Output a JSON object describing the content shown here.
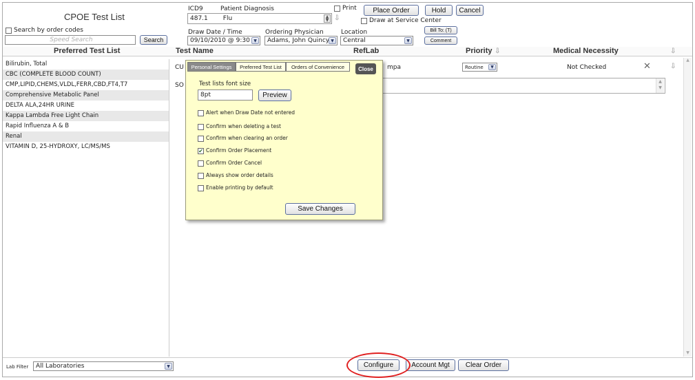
{
  "header": {
    "title": "CPOE Test List",
    "search_by_codes_label": "Search by order codes",
    "speed_search_placeholder": "Speed Search",
    "search_button": "Search"
  },
  "diagnosis": {
    "icd9_label": "ICD9",
    "patient_diagnosis_label": "Patient Diagnosis",
    "icd9_value": "487.1",
    "diagnosis_value": "Flu"
  },
  "order": {
    "print_label": "Print",
    "place_order_button": "Place Order",
    "hold_button": "Hold",
    "cancel_button": "Cancel",
    "draw_at_service_center_label": "Draw at Service Center",
    "draw_date_label": "Draw Date / Time",
    "draw_date_value": "09/10/2010 @ 9:30",
    "ordering_physician_label": "Ordering Physician",
    "ordering_physician_value": "Adams, John Quincy",
    "location_label": "Location",
    "location_value": "Central",
    "bill_to_button": "Bill To: (T)",
    "comment_button": "Comment"
  },
  "preferred_list": {
    "header": "Preferred Test List",
    "items": [
      "Bilirubin, Total",
      "CBC (COMPLETE BLOOD COUNT)",
      "CMP,LIPID,CHEMS,VLDL,FERR,CBD,FT4,T7",
      "Comprehensive Metabolic Panel",
      "DELTA ALA,24HR URINE",
      "Kappa Lambda Free Light Chain",
      "Rapid Influenza A & B",
      "Renal",
      "VITAMIN D, 25-HYDROXY, LC/MS/MS"
    ]
  },
  "grid": {
    "col_test_name": "Test Name",
    "col_reflab": "RefLab",
    "col_priority": "Priority",
    "col_medical_necessity": "Medical Necessity",
    "row1_test_partial": "CU",
    "row1_reflab_partial": "mpa",
    "row1_priority": "Routine",
    "row1_necessity": "Not Checked",
    "row2_test_partial": "SO"
  },
  "popup": {
    "tab_personal": "Personal Settings",
    "tab_preferred": "Preferred Test List",
    "tab_convenience": "Orders of Convenience",
    "close_button": "Close",
    "font_size_label": "Test lists font size",
    "font_size_value": "8pt",
    "preview_button": "Preview",
    "options": [
      {
        "label": "Alert when Draw Date not entered",
        "checked": false
      },
      {
        "label": "Confirm when deleting a test",
        "checked": false
      },
      {
        "label": "Confirm when clearing an order",
        "checked": false
      },
      {
        "label": "Confirm Order Placement",
        "checked": true
      },
      {
        "label": "Confirm Order Cancel",
        "checked": false
      },
      {
        "label": "Always show order details",
        "checked": false
      },
      {
        "label": "Enable printing by default",
        "checked": false
      }
    ],
    "save_button": "Save Changes"
  },
  "footer": {
    "lab_filter_label": "Lab Filter",
    "lab_filter_value": "All Laboratories",
    "configure_button": "Configure",
    "account_mgt_button": "Account Mgt",
    "clear_order_button": "Clear Order"
  }
}
